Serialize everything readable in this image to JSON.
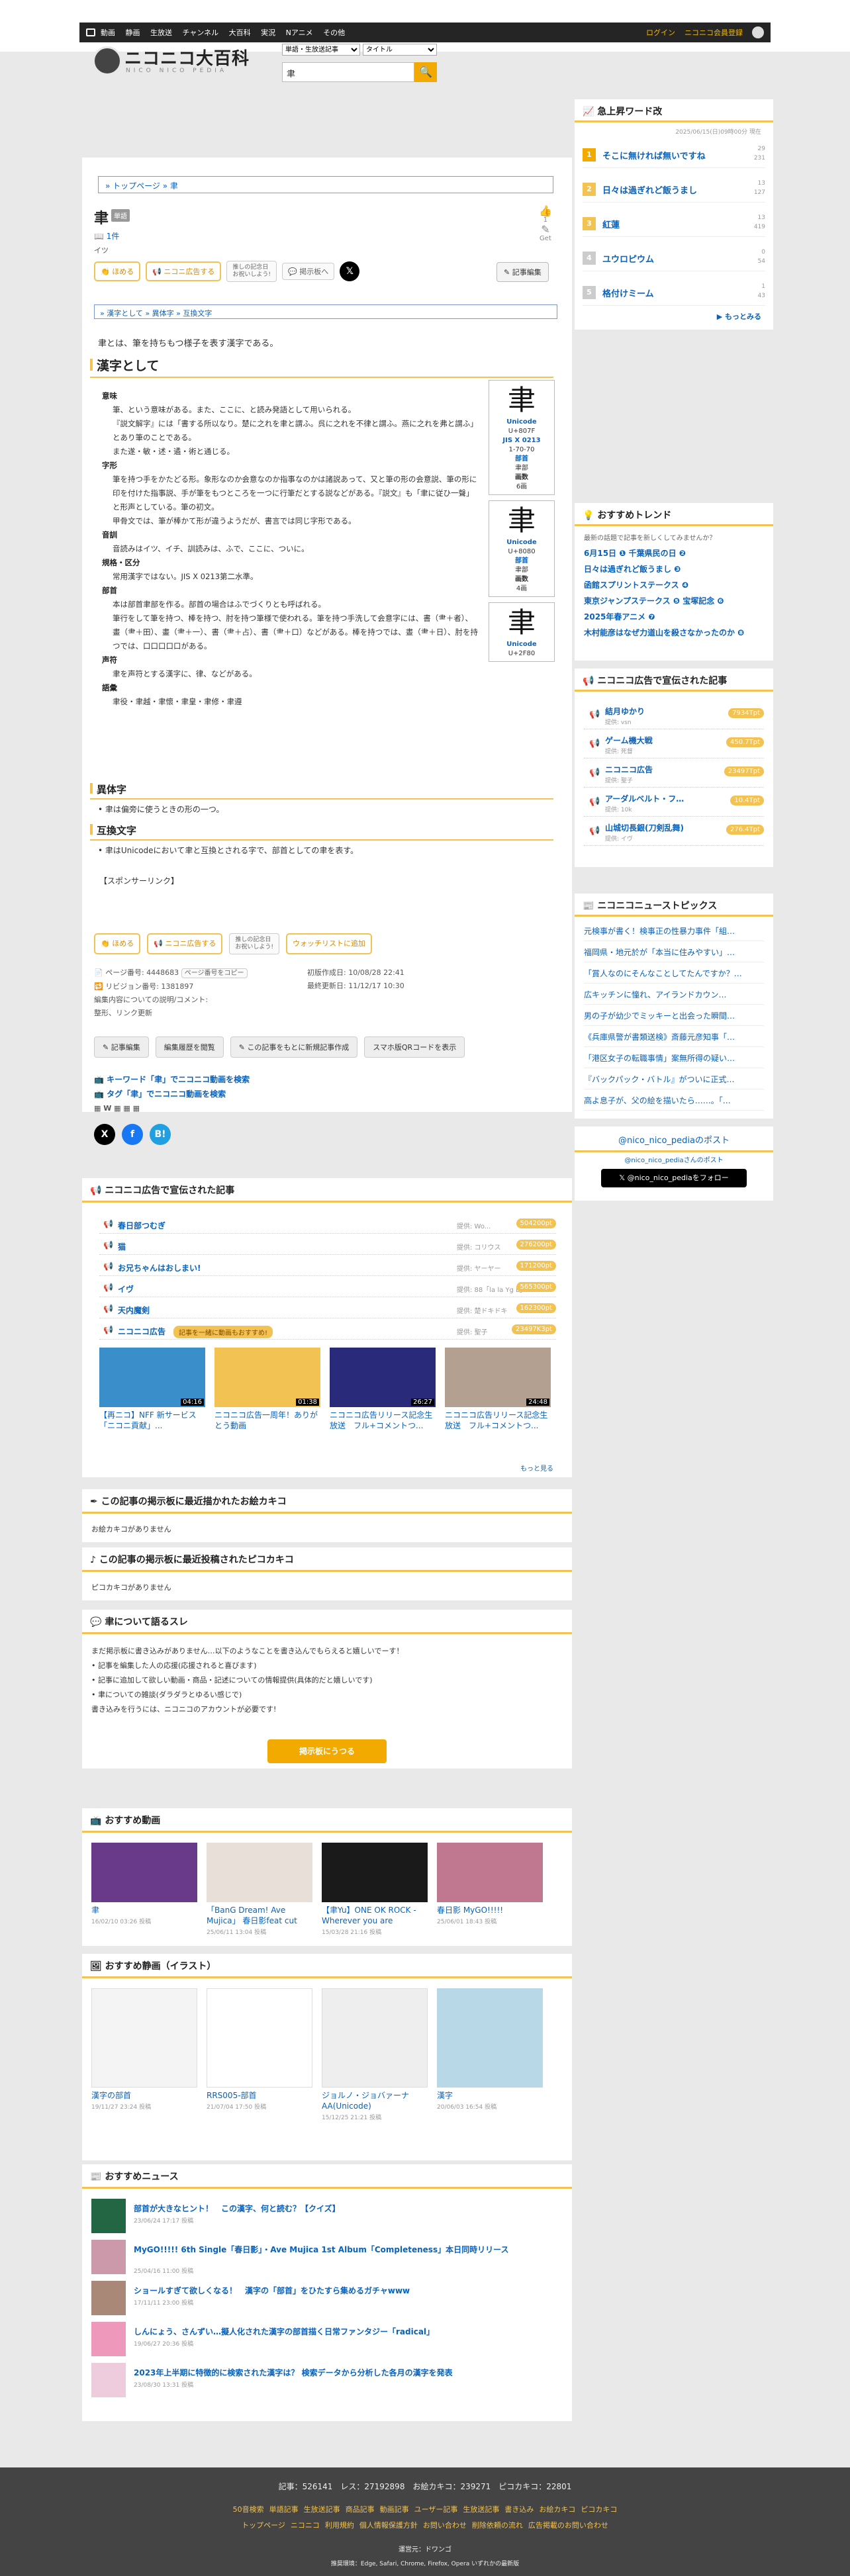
{
  "nicobar": {
    "nav": [
      "動画",
      "静画",
      "生放送",
      "チャンネル",
      "大百科",
      "実況",
      "Nアニメ",
      "その他"
    ],
    "login": "ログイン",
    "register": "ニコニコ会員登録"
  },
  "logo": {
    "title": "ニコニコ大百科",
    "sub": "NICO NICO PEDIA"
  },
  "search": {
    "scope": "単語・生放送記事",
    "mode": "タイトル",
    "query": "聿",
    "button": "🔍"
  },
  "article": {
    "breadcrumb": "» トップページ » 聿",
    "title": "聿",
    "yomi_badge": "単語",
    "count": "1件",
    "sub": "イツ",
    "like_count": "1",
    "like_label": "Get",
    "buttons": {
      "homeru": "ほめる",
      "kokoku": "ニコニ広告する",
      "memorial": "推しの記念日\nお祝いしよう!",
      "jitsuha": "掲示板へ",
      "x": "𝕏",
      "edit": "記事編集"
    },
    "toc": "» 漢字として » 異体字 » 互換文字",
    "intro": "聿とは、筆を持ちもつ様子を表す漢字である。",
    "section_title": "漢字として",
    "labels": [
      "意味",
      "字形",
      "音訓",
      "規格・区分",
      "部首",
      "声符",
      "語彙"
    ],
    "texts": [
      "筆、という意味がある。また、ここに、と読み発語として用いられる。",
      "『説文解字』には「書する所以なり。楚に之れを聿と謂ふ。呉に之れを不律と謂ふ。燕に之れを弗と謂ふ」とあり筆のことである。",
      "また遂・敏・述・遹・術と通じる。",
      "筆を持つ手をかたどる形。象形なのか会意なのか指事なのかは諸説あって、又と筆の形の会意説、筆の形に印を付けた指事説、手が筆をもつところを一つに行筆だとする説などがある。『説文』も「聿に従ひ一聲」と形声としている。筆の初文。",
      "甲骨文では、筆が棒かて形が違うようだが、書言では同じ字形である。",
      "音読みはイツ、イチ、訓読みは、ふで、ここに、ついに。",
      "常用漢字ではない。JIS X 0213第二水準。",
      "本は部首聿部を作る。部首の場合はふでづくりとも呼ばれる。",
      "筆行をして筆を持つ、棒を持つ、肘を持つ筆様で使われる。筆を持つ手洗して会意字には、書（⺻＋者）、畫（⺻＋田）、畫（⺻＋一）、書（⺻＋占）、書（⺻＋口）などがある。棒を持つでは、晝（⺻＋日）、肘を持つでは、口口口口口がある。",
      "聿を声符とする漢字に、律、などがある。",
      "聿役・聿越・聿懷・聿皇・聿修・聿遵"
    ],
    "unicode_boxes": [
      {
        "glyph": "聿",
        "code": "Unicode",
        "cp": "U+807F",
        "jis": "JIS X 0213",
        "jis_cp": "1-70-70",
        "bushu_lbl": "部首",
        "bushu": "聿部",
        "kakusu_lbl": "画数",
        "kakusu": "6画"
      },
      {
        "glyph": "聿",
        "code": "Unicode",
        "cp": "U+8080",
        "bushu_lbl": "部首",
        "bushu": "聿部",
        "kakusu_lbl": "画数",
        "kakusu": "4画"
      },
      {
        "glyph": "聿",
        "code": "Unicode",
        "cp": "U+2F80"
      }
    ],
    "itai_title": "異体字",
    "itai_text": "• 聿は偏旁に使うときの形の一つ。",
    "gokan_title": "互換文字",
    "gokan_text": "• 聿はUnicodeにおいて聿と互換とされる字で、部首としての聿を表す。",
    "sponsor": "【スポンサーリンク】",
    "watch_button": "ウォッチリストに追加",
    "meta": {
      "page_no": "ページ番号: 4448683",
      "page_copy": "ページ番号をコピー",
      "revision": "リビジョン番号: 1381897",
      "edit_note": "編集内容についての説明/コメント:",
      "edit_note2": "整形、リンク更新",
      "created": "初版作成日: 10/08/28 22:41",
      "updated": "最終更新日: 11/12/17 10:30"
    },
    "dbtns": [
      "記事編集",
      "編集履歴を閲覧",
      "この記事をもとに新規記事作成",
      "スマホ版QRコードを表示"
    ],
    "kw1": "キーワード「聿」でニコニコ動画を検索",
    "kw2": "タグ「聿」でニコニコ動画を検索"
  },
  "ads_box": {
    "title": "ニコニコ広告で宣伝された記事",
    "rows": [
      {
        "name": "春日部つむぎ",
        "by": "提供: Wo...",
        "pts": "504200pt"
      },
      {
        "name": "猫",
        "by": "提供: コリウス",
        "pts": "276200pt"
      },
      {
        "name": "お兄ちゃんはおしまい!",
        "by": "提供: ヤーヤー",
        "pts": "171200pt"
      },
      {
        "name": "イヴ",
        "by": "提供: 88「la la Yg L」",
        "pts": "565300pt"
      },
      {
        "name": "天内魔剣",
        "by": "提供: 楚ドキドキ",
        "pts": "162300pt"
      },
      {
        "name": "ニコニコ広告",
        "by": "提供: 聖子",
        "pts": "23497K3pt"
      }
    ],
    "campaign": "記事を一緒に動画もおすすめ!",
    "videos": [
      {
        "cap": "【再ニコ】NFF 新サービス「ニコニ貢献」...",
        "dur": "04:16",
        "color": "#3a8ec9"
      },
      {
        "cap": "ニコニコ広告一周年！ありがとう動画",
        "dur": "01:38",
        "color": "#f2c252"
      },
      {
        "cap": "ニコニコ広告リリース記念生放送　フル+コメントつ...",
        "dur": "26:27",
        "color": "#2a2a7a"
      },
      {
        "cap": "ニコニコ広告リリース記念生放送　フル+コメントつ...",
        "dur": "24:48",
        "color": "#b3a090"
      }
    ],
    "more": "もっと見る"
  },
  "oekaki": {
    "title": "この記事の掲示板に最近描かれたお絵カキコ",
    "empty": "お絵カキコがありません"
  },
  "picoka": {
    "title": "この記事の掲示板に最近投稿されたピコカキコ",
    "empty": "ピコカキコがありません"
  },
  "bbs": {
    "title": "聿について語るスレ",
    "lines": [
      "まだ掲示板に書き込みがありません…以下のようなことを書き込んでもらえると嬉しいでーす！",
      "• 記事を編集した人の応援(応援されると喜びます)",
      "• 記事に追加して欲しい動画・商品・記述についての情報提供(具体的だと嬉しいです)",
      "• 聿についての雑談(ダラダラとゆるい感じで)",
      "書き込みを行うには、ニコニコのアカウントが必要です!"
    ],
    "button": "掲示板にうつる"
  },
  "rec_videos": {
    "title": "おすすめ動画",
    "items": [
      {
        "cap": "聿",
        "dt": "16/02/10 03:26 投稿",
        "color": "#6a3a8a"
      },
      {
        "cap": "「BanG Dream! Ave Mujica」 春日影feat cut",
        "dt": "25/06/11 13:04 投稿",
        "color": "#e8e0d8"
      },
      {
        "cap": "【聿Yu】ONE OK ROCK -Wherever you are",
        "dt": "15/03/28 21:16 投稿",
        "color": "#1a1a1a"
      },
      {
        "cap": "春日影 MyGO!!!!!",
        "dt": "25/06/01 18:43 投稿",
        "color": "#c07890"
      }
    ]
  },
  "rec_seiga": {
    "title": "おすすめ静画（イラスト）",
    "items": [
      {
        "cap": "漢字の部首",
        "dt": "19/11/27 23:24 投稿",
        "color": "#f4f4f4"
      },
      {
        "cap": "RRS005-部首",
        "dt": "21/07/04 17:50 投稿",
        "color": "#fff"
      },
      {
        "cap": "ジョルノ・ジョバァーナAA(Unicode)",
        "dt": "15/12/25 21:21 投稿",
        "color": "#eee"
      },
      {
        "cap": "漢字",
        "dt": "20/06/03 16:54 投稿",
        "color": "#b8d8e8"
      }
    ]
  },
  "rec_news": {
    "title": "おすすめニュース",
    "items": [
      {
        "t": "部首が大きなヒント！　この漢字、何と読む？【クイズ】",
        "d": "23/06/24 17:17 投稿"
      },
      {
        "t": "MyGO!!!!! 6th Single「春日影」・Ave Mujica 1st Album「Completeness」本日同時リリース",
        "d": "25/04/16 11:00 投稿"
      },
      {
        "t": "ショールすぎて欲しくなる！　漢字の「部首」をひたすら集めるガチャwww",
        "d": "17/11/11 23:00 投稿"
      },
      {
        "t": "しんにょう、さんずい…擬人化された漢字の部首描く日常ファンタジー「radical」",
        "d": "19/06/27 20:36 投稿"
      },
      {
        "t": "2023年上半期に特徴的に検索された漢字は？ 検索データから分析した各月の漢字を発表",
        "d": "23/08/30 13:31 投稿"
      }
    ]
  },
  "sidebar": {
    "rank_title": "急上昇ワード改",
    "rank_date": "2025/06/15(日)09時00分 現在",
    "ranks": [
      {
        "n": "1",
        "name": "そこに無ければ無いですね",
        "s1": "29",
        "s2": "231",
        "color": "#f2a900"
      },
      {
        "n": "2",
        "name": "日々は過ぎれど飯うまし",
        "s1": "13",
        "s2": "127",
        "color": "#f2c252"
      },
      {
        "n": "3",
        "name": "紅蓮",
        "s1": "13",
        "s2": "419",
        "color": "#f2c252"
      },
      {
        "n": "4",
        "name": "ユウロピウム",
        "s1": "0",
        "s2": "54",
        "color": "#ccc"
      },
      {
        "n": "5",
        "name": "格付けミーム",
        "s1": "1",
        "s2": "43",
        "color": "#ccc"
      }
    ],
    "rank_more": "▶ もっとみる",
    "trend_title": "おすすめトレンド",
    "trend_desc": "最新の話題で記事を新しくしてみませんか？",
    "trends": [
      "6月15日 ❶ 千葉県民の日 ❷",
      "日々は過ぎれど飯うまし ❸",
      "函館スプリントステークス ❹",
      "東京ジャンプステークス ❺ 宝塚記念 ❻",
      "2025年春アニメ ❼",
      "木村能彦はなぜ力道山を殺さなかったのか ❽"
    ],
    "sad_title": "ニコニコ広告で宣伝された記事",
    "sads": [
      {
        "name": "結月ゆかり",
        "by": "提供: vsn",
        "pts": "7934Tpt"
      },
      {
        "name": "ゲーム機大戦",
        "by": "提供: 死督",
        "pts": "450.7Tpt"
      },
      {
        "name": "ニコニコ広告",
        "by": "提供: 聖子",
        "pts": "23497Tpt"
      },
      {
        "name": "アーダルベルト・フ…",
        "by": "提供: 10k",
        "pts": "10.4Tpt"
      },
      {
        "name": "山城切長銀(刀剣乱舞)",
        "by": "提供: イヴ",
        "pts": "276.4Tpt"
      }
    ],
    "news_title": "ニコニコニューストピックス",
    "news": [
      "元検事が書く！検事正の性暴力事件「組…",
      "福岡県・地元於が「本当に住みやすい」…",
      "「賞人なのにそんなことしてたんですか？…",
      "広キッチンに憧れ、アイランドカウン…",
      "男の子が幼少でミッキーと出会った瞬間…",
      "《兵庫県警が書類送検》斎藤元彦知事「…",
      "「港区女子の転職事情」案無所得の疑い…",
      "『バックパック・バトル』がついに正式…",
      "高よ息子が、父の絵を描いたら……。「…"
    ],
    "x_post_title": "@nico_nico_pediaのポスト",
    "x_post_sub": "@nico_nico_pediaさんのポスト",
    "x_follow": "𝕏 @nico_nico_pediaをフォロー"
  },
  "footer": {
    "stats": "記事：526141　レス：27192898　お絵カキコ：239271　ピコカキコ：22801",
    "links1": [
      "50音検索",
      "単語記事",
      "生放送記事",
      "商品記事",
      "動画記事",
      "ユーザー記事",
      "生放送記事",
      "書き込み",
      "お絵カキコ",
      "ピコカキコ"
    ],
    "links2": [
      "トップページ",
      "ニコニコ",
      "利用規約",
      "個人情報保護方針",
      "お問い合わせ",
      "削除依頼の流れ",
      "広告掲載のお問い合わせ"
    ],
    "operator": "運営元：ドワンゴ",
    "browsers": "推奨環境：Edge, Safari, Chrome, Firefox, Opera いずれかの最新版"
  }
}
